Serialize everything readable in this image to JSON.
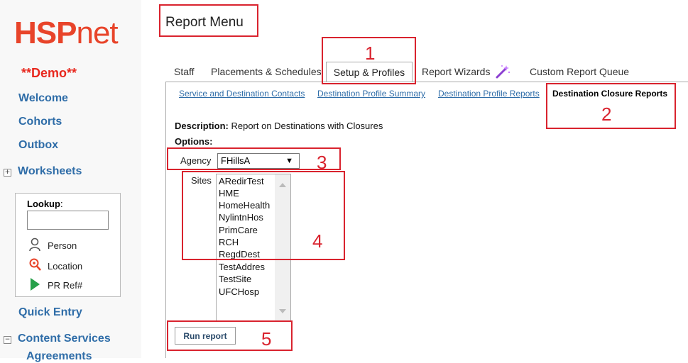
{
  "sidebar": {
    "logo_hsp": "HSP",
    "logo_net": "net",
    "demo": "**Demo**",
    "nav": {
      "welcome": "Welcome",
      "cohorts": "Cohorts",
      "outbox": "Outbox",
      "worksheets": "Worksheets",
      "quick_entry": "Quick Entry",
      "content_services": "Content Services",
      "agreements": "Agreements"
    },
    "expand_symbol": "+",
    "collapse_symbol": "−",
    "lookup": {
      "label": "Lookup",
      "colon": ":",
      "input_value": "",
      "items": {
        "person": "Person",
        "location": "Location",
        "pr_ref": "PR Ref#"
      }
    }
  },
  "main": {
    "title": "Report Menu",
    "tabs": {
      "staff": "Staff",
      "placements": "Placements & Schedules",
      "setup": "Setup & Profiles",
      "wizards": "Report Wizards",
      "queue": "Custom Report Queue"
    },
    "subtabs": {
      "contacts": "Service and Destination Contacts",
      "summary": "Destination Profile Summary",
      "profile_reports": "Destination Profile Reports",
      "closure": "Destination Closure Reports"
    },
    "description_label": "Description:",
    "description_text": "Report on Destinations with Closures",
    "options_label": "Options:",
    "agency_label": "Agency",
    "agency_value": "FHillsA",
    "sites_label": "Sites",
    "sites": [
      "ARedirTest",
      "HME",
      "HomeHealth",
      "NylintnHos",
      "PrimCare",
      "RCH",
      "RegdDest",
      "TestAddres",
      "TestSite",
      "UFCHosp"
    ],
    "run_button": "Run report"
  },
  "annotations": [
    "1",
    "2",
    "3",
    "4",
    "5"
  ],
  "colors": {
    "annotation": "#d9232e",
    "link": "#2f6da8",
    "brand": "#e8442a"
  }
}
